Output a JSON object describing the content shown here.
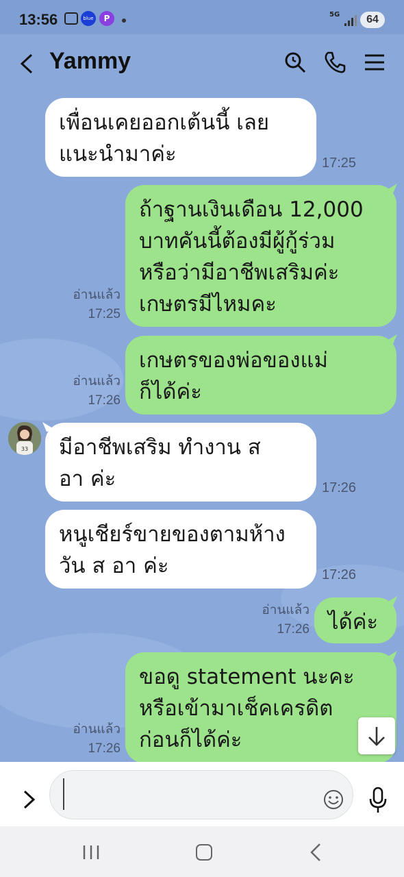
{
  "status_bar": {
    "time": "13:56",
    "network": "5G",
    "battery": "64",
    "blue_app_label": "blue"
  },
  "header": {
    "title": "Yammy",
    "icons": [
      "back-icon",
      "search-icon",
      "phone-icon",
      "menu-icon"
    ]
  },
  "messages": [
    {
      "side": "in",
      "text": "เพื่อนเคยออกเต้นนี้ เลย\nแนะนำมาค่ะ",
      "time": "17:25"
    },
    {
      "side": "out",
      "text": "ถ้าฐานเงินเดือน 12,000\nบาทคันนี้ต้องมีผู้กู้ร่วม\nหรือว่ามีอาชีพเสริมค่ะ\nเกษตรมีไหมคะ",
      "read": "อ่านแล้ว",
      "time": "17:25"
    },
    {
      "side": "out",
      "text": "เกษตรของพ่อของแม่\nก็ได้ค่ะ",
      "read": "อ่านแล้ว",
      "time": "17:26"
    },
    {
      "side": "in",
      "text": "มีอาชีพเสริม ทำงาน ส\nอา ค่ะ",
      "time": "17:26"
    },
    {
      "side": "in",
      "text": "หนูเชียร์ขายของตามห้าง\nวัน ส อา ค่ะ",
      "time": "17:26"
    },
    {
      "side": "out",
      "text": "ได้ค่ะ",
      "read": "อ่านแล้ว",
      "time": "17:26"
    },
    {
      "side": "out",
      "text": "ขอดู statement นะคะ\nหรือเข้ามาเช็คเครดิต\nก่อนก็ได้ค่ะ",
      "read": "อ่านแล้ว",
      "time": "17:26"
    }
  ],
  "input": {
    "placeholder": ""
  },
  "colors": {
    "background": "#8aa9da",
    "outgoing": "#9de38c",
    "incoming": "#ffffff"
  }
}
